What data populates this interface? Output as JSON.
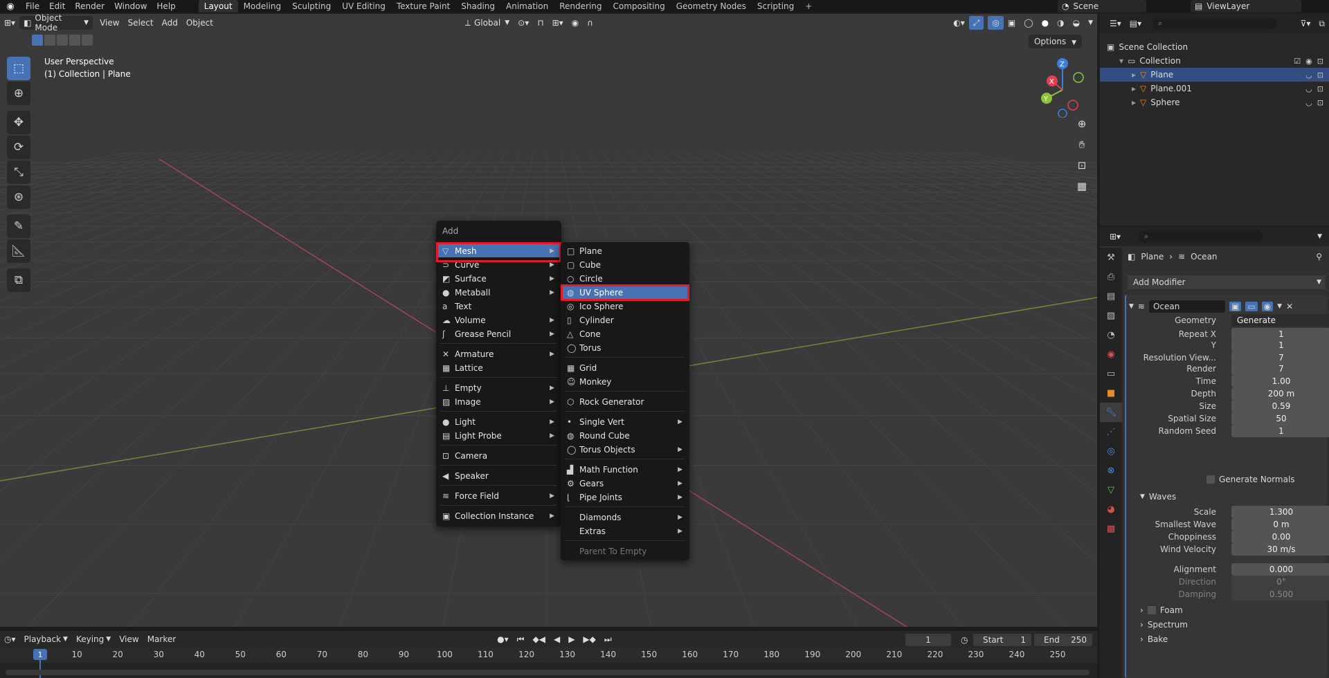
{
  "topbar": {
    "menus": [
      "File",
      "Edit",
      "Render",
      "Window",
      "Help"
    ],
    "workspaces": [
      "Layout",
      "Modeling",
      "Sculpting",
      "UV Editing",
      "Texture Paint",
      "Shading",
      "Animation",
      "Rendering",
      "Compositing",
      "Geometry Nodes",
      "Scripting"
    ],
    "active_workspace": "Layout",
    "add_workspace": "+",
    "scene": "Scene",
    "view_layer": "ViewLayer"
  },
  "viewport": {
    "mode": "Object Mode",
    "menus": [
      "View",
      "Select",
      "Add",
      "Object"
    ],
    "transform_orientation": "Global",
    "options": "Options",
    "info_line1": "User Perspective",
    "info_line2": "(1) Collection | Plane",
    "gizmo_axes": [
      "X",
      "Y",
      "Z"
    ]
  },
  "add_menu": {
    "title": "Add",
    "items": [
      {
        "label": "Mesh",
        "icon": "mesh-icon",
        "glyph": "▽",
        "submenu": true,
        "highlighted": true
      },
      {
        "label": "Curve",
        "icon": "curve-icon",
        "glyph": "⊃",
        "submenu": true
      },
      {
        "label": "Surface",
        "icon": "surface-icon",
        "glyph": "◩",
        "submenu": true
      },
      {
        "label": "Metaball",
        "icon": "metaball-icon",
        "glyph": "●",
        "submenu": true
      },
      {
        "label": "Text",
        "icon": "text-icon",
        "glyph": "a",
        "submenu": false
      },
      {
        "label": "Volume",
        "icon": "volume-icon",
        "glyph": "☁",
        "submenu": true
      },
      {
        "label": "Grease Pencil",
        "icon": "grease-pencil-icon",
        "glyph": "ʃ",
        "submenu": true
      },
      {
        "label": "Armature",
        "icon": "armature-icon",
        "glyph": "✕",
        "submenu": true
      },
      {
        "label": "Lattice",
        "icon": "lattice-icon",
        "glyph": "▦",
        "submenu": false
      },
      {
        "label": "Empty",
        "icon": "empty-icon",
        "glyph": "⊥",
        "submenu": true
      },
      {
        "label": "Image",
        "icon": "image-icon",
        "glyph": "▨",
        "submenu": true
      },
      {
        "label": "Light",
        "icon": "light-icon",
        "glyph": "●",
        "submenu": true
      },
      {
        "label": "Light Probe",
        "icon": "light-probe-icon",
        "glyph": "▤",
        "submenu": true
      },
      {
        "label": "Camera",
        "icon": "camera-icon",
        "glyph": "⊡",
        "submenu": false
      },
      {
        "label": "Speaker",
        "icon": "speaker-icon",
        "glyph": "◀",
        "submenu": false
      },
      {
        "label": "Force Field",
        "icon": "force-field-icon",
        "glyph": "≋",
        "submenu": true
      },
      {
        "label": "Collection Instance",
        "icon": "collection-instance-icon",
        "glyph": "▣",
        "submenu": true
      }
    ]
  },
  "mesh_menu": {
    "items": [
      {
        "label": "Plane",
        "icon": "plane-icon",
        "glyph": "□",
        "submenu": false
      },
      {
        "label": "Cube",
        "icon": "cube-icon",
        "glyph": "▢",
        "submenu": false
      },
      {
        "label": "Circle",
        "icon": "circle-icon",
        "glyph": "○",
        "submenu": false
      },
      {
        "label": "UV Sphere",
        "icon": "uv-sphere-icon",
        "glyph": "◍",
        "submenu": false,
        "highlighted": true
      },
      {
        "label": "Ico Sphere",
        "icon": "ico-sphere-icon",
        "glyph": "◎",
        "submenu": false
      },
      {
        "label": "Cylinder",
        "icon": "cylinder-icon",
        "glyph": "▯",
        "submenu": false
      },
      {
        "label": "Cone",
        "icon": "cone-icon",
        "glyph": "△",
        "submenu": false
      },
      {
        "label": "Torus",
        "icon": "torus-icon",
        "glyph": "◯",
        "submenu": false
      },
      {
        "label": "Grid",
        "icon": "grid-icon",
        "glyph": "▦",
        "submenu": false
      },
      {
        "label": "Monkey",
        "icon": "monkey-icon",
        "glyph": "☺",
        "submenu": false
      },
      {
        "label": "Rock Generator",
        "icon": "rock-generator-icon",
        "glyph": "⬡",
        "submenu": false
      },
      {
        "label": "Single Vert",
        "icon": "single-vert-icon",
        "glyph": "•",
        "submenu": true
      },
      {
        "label": "Round Cube",
        "icon": "round-cube-icon",
        "glyph": "◍",
        "submenu": false
      },
      {
        "label": "Torus Objects",
        "icon": "torus-objects-icon",
        "glyph": "◯",
        "submenu": true
      },
      {
        "label": "Math Function",
        "icon": "math-function-icon",
        "glyph": "▟",
        "submenu": true
      },
      {
        "label": "Gears",
        "icon": "gears-icon",
        "glyph": "⚙",
        "submenu": true
      },
      {
        "label": "Pipe Joints",
        "icon": "pipe-joints-icon",
        "glyph": "⌊",
        "submenu": true
      },
      {
        "label": "Diamonds",
        "icon": "diamonds-icon",
        "glyph": "",
        "submenu": true
      },
      {
        "label": "Extras",
        "icon": "extras-icon",
        "glyph": "",
        "submenu": true
      },
      {
        "label": "Parent To Empty",
        "icon": "parent-to-empty-icon",
        "glyph": "",
        "submenu": false,
        "disabled": true
      }
    ]
  },
  "timeline": {
    "menus": [
      "Playback",
      "Keying",
      "View",
      "Marker"
    ],
    "current_frame": "1",
    "start_label": "Start",
    "start_value": "1",
    "end_label": "End",
    "end_value": "250",
    "ticks": [
      "1",
      "10",
      "20",
      "30",
      "40",
      "50",
      "60",
      "70",
      "80",
      "90",
      "100",
      "110",
      "120",
      "130",
      "140",
      "150",
      "160",
      "170",
      "180",
      "190",
      "200",
      "210",
      "220",
      "230",
      "240",
      "250"
    ]
  },
  "outliner": {
    "rows": [
      {
        "label": "Scene Collection",
        "indent": 0
      },
      {
        "label": "Collection",
        "indent": 1
      },
      {
        "label": "Plane",
        "indent": 2,
        "selected": true
      },
      {
        "label": "Plane.001",
        "indent": 2
      },
      {
        "label": "Sphere",
        "indent": 2
      }
    ]
  },
  "properties": {
    "breadcrumb_object": "Plane",
    "breadcrumb_modifier": "Ocean",
    "add_modifier": "Add Modifier",
    "modifier_name": "Ocean",
    "fields": [
      {
        "label": "Geometry",
        "value": "Generate",
        "dropdown": true
      },
      {
        "label": "Repeat X",
        "value": "1"
      },
      {
        "label": "Y",
        "value": "1"
      },
      {
        "label": "Resolution View...",
        "value": "7"
      },
      {
        "label": "Render",
        "value": "7"
      },
      {
        "label": "Time",
        "value": "1.00"
      },
      {
        "label": "Depth",
        "value": "200 m"
      },
      {
        "label": "Size",
        "value": "0.59"
      },
      {
        "label": "Spatial Size",
        "value": "50"
      },
      {
        "label": "Random Seed",
        "value": "1"
      }
    ],
    "generate_normals": "Generate Normals",
    "waves_title": "Waves",
    "wave_fields": [
      {
        "label": "Scale",
        "value": "1.300"
      },
      {
        "label": "Smallest Wave",
        "value": "0 m"
      },
      {
        "label": "Choppiness",
        "value": "0.00"
      },
      {
        "label": "Wind Velocity",
        "value": "30 m/s"
      }
    ],
    "extra_fields": [
      {
        "label": "Alignment",
        "value": "0.000"
      },
      {
        "label": "Direction",
        "value": "0°",
        "disabled": true
      },
      {
        "label": "Damping",
        "value": "0.500",
        "disabled": true
      }
    ],
    "sections": [
      "Foam",
      "Spectrum",
      "Bake"
    ]
  },
  "colors": {
    "accent": "#4772b3",
    "highlight_box": "#e21a2a",
    "x_axis": "#e04050",
    "y_axis": "#8cc43c",
    "z_axis": "#3d7ed8"
  }
}
